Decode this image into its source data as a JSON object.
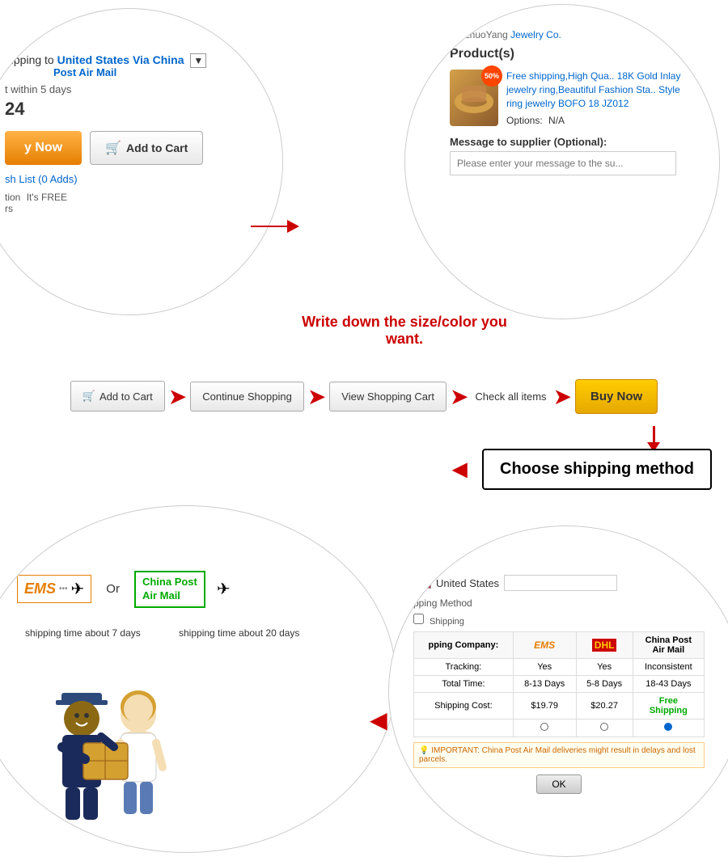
{
  "seller": {
    "prefix": "er: ZhuoYang",
    "name": "Jewelry Co."
  },
  "top_left": {
    "shipping_label": "hipping to",
    "shipping_link": "United States Via China",
    "shipping_sub": "Post Air Mail",
    "within_days": "t within 5 days",
    "price": "24",
    "buy_now_label": "y Now",
    "add_to_cart_label": "Add to Cart",
    "wish_list_label": "sh List (0 Adds)",
    "protection_label": "tion",
    "protection_value": "It's FREE",
    "protection_sub": "rs"
  },
  "top_right": {
    "products_label": "Product(s)",
    "discount": "50%",
    "product_title": "Free shipping,High Qua.. 18K Gold Inlay jewelry ring,Beautiful Fashion Sta.. Style ring jewelry BOFO 18 JZ012",
    "options_label": "Options:",
    "options_value": "N/A",
    "message_label": "Message to supplier (Optional):",
    "message_placeholder": "Please enter your message to the su..."
  },
  "write_down": "Write down the size/color you want.",
  "flow": {
    "step1": "Add to Cart",
    "step2": "Continue Shopping",
    "step3": "View Shopping Cart",
    "step4": "Check all items",
    "step5": "Buy Now"
  },
  "choose_shipping": {
    "label": "Choose shipping method"
  },
  "bottom_left": {
    "ems_label": "EMS",
    "or_label": "Or",
    "china_post_line1": "China Post",
    "china_post_line2": "Air Mail",
    "ems_time": "shipping time about 7 days",
    "china_post_time": "shipping time about 20 days"
  },
  "bottom_right": {
    "country": "United States",
    "shipping_method_label": "pping Method",
    "free_shipping_label": "Shipping",
    "company_label": "pping Company:",
    "ems_col": "EMS",
    "dhl_col": "DHL",
    "china_post_col": "China Post\nAir Mail",
    "tracking_label": "Tracking:",
    "tracking_ems": "Yes",
    "tracking_dhl": "Yes",
    "tracking_china": "Inconsistent",
    "total_time_label": "Total Time:",
    "total_ems": "8-13 Days",
    "total_dhl": "5-8 Days",
    "total_china": "18-43 Days",
    "cost_label": "Shipping Cost:",
    "cost_ems": "$19.79",
    "cost_dhl": "$20.27",
    "cost_china": "Free\nShipping",
    "important_note": "IMPORTANT: China Post Air Mail deliveries might result in delays and lost parcels.",
    "ok_label": "OK"
  }
}
